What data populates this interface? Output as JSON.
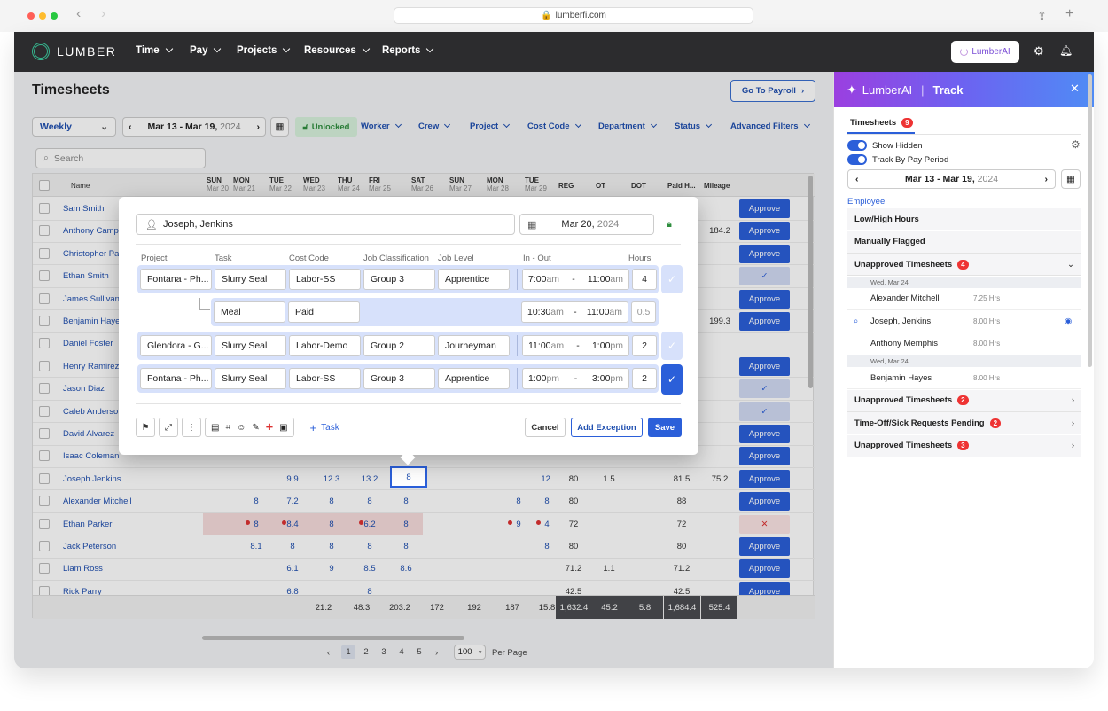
{
  "browser": {
    "url": "lumberfi.com"
  },
  "topbar": {
    "brand": "LUMBER",
    "nav": [
      "Time",
      "Pay",
      "Projects",
      "Resources",
      "Reports"
    ],
    "ai_button": "LumberAI"
  },
  "page": {
    "title": "Timesheets",
    "go_payroll": "Go To Payroll",
    "period": "Weekly",
    "range": "Mar 13 - Mar 19,",
    "range_year": "2024",
    "lock_status": "Unlocked",
    "filters": [
      "Worker",
      "Crew",
      "Project",
      "Cost Code",
      "Department",
      "Status",
      "Advanced Filters"
    ],
    "search_placeholder": "Search"
  },
  "grid": {
    "headers": [
      {
        "d": "SUN",
        "s": "Mar 20"
      },
      {
        "d": "MON",
        "s": "Mar 21"
      },
      {
        "d": "TUE",
        "s": "Mar 22"
      },
      {
        "d": "WED",
        "s": "Mar 23"
      },
      {
        "d": "THU",
        "s": "Mar 24"
      },
      {
        "d": "FRI",
        "s": "Mar 25"
      },
      {
        "d": "SAT",
        "s": "Mar 26"
      },
      {
        "d": "SUN",
        "s": "Mar 27"
      },
      {
        "d": "MON",
        "s": "Mar 28"
      },
      {
        "d": "TUE",
        "s": "Mar 29"
      }
    ],
    "cols": {
      "name": "Name",
      "reg": "REG",
      "ot": "OT",
      "dot": "DOT",
      "paid": "Paid H...",
      "mileage": "Mileage"
    },
    "rows": [
      {
        "name": "Sam Smith",
        "action": "Approve"
      },
      {
        "name": "Anthony Camp",
        "action": "Approve",
        "mileage": "184.2"
      },
      {
        "name": "Christopher Pa",
        "action": "Approve"
      },
      {
        "name": "Ethan Smith",
        "action": "ok"
      },
      {
        "name": "James Sullivan",
        "action": "Approve"
      },
      {
        "name": "Benjamin Haye",
        "action": "Approve",
        "mileage": "199.3"
      },
      {
        "name": "Daniel Foster",
        "action": ""
      },
      {
        "name": "Henry Ramirez",
        "action": "Approve"
      },
      {
        "name": "Jason Diaz",
        "action": "ok"
      },
      {
        "name": "Caleb Anderso",
        "action": "ok"
      },
      {
        "name": "David Alvarez",
        "action": "Approve"
      },
      {
        "name": "Isaac Coleman",
        "action": "Approve"
      },
      {
        "name": "Joseph Jenkins",
        "action": "Approve",
        "days": [
          "",
          "",
          "9.9",
          "12.3",
          "13.2",
          "8",
          "",
          "",
          "",
          "12."
        ],
        "reg": "80",
        "ot": "1.5",
        "dot": "",
        "paid": "81.5",
        "mileage": "75.2"
      },
      {
        "name": "Alexander Mitchell",
        "action": "Approve",
        "days": [
          "",
          "8",
          "7.2",
          "8",
          "8",
          "8",
          "",
          "",
          "8",
          "8"
        ],
        "reg": "80",
        "ot": "",
        "dot": "",
        "paid": "88",
        "mileage": ""
      },
      {
        "name": "Ethan Parker",
        "action": "reject",
        "days": [
          "",
          "8",
          "8.4",
          "8",
          "6.2",
          "8",
          "",
          "",
          "9",
          "4"
        ],
        "reg": "72",
        "ot": "",
        "dot": "",
        "paid": "72",
        "mileage": ""
      },
      {
        "name": "Jack Peterson",
        "action": "Approve",
        "days": [
          "",
          "8.1",
          "8",
          "8",
          "8",
          "8",
          "",
          "",
          "",
          "8"
        ],
        "reg": "80",
        "ot": "",
        "dot": "",
        "paid": "80",
        "mileage": ""
      },
      {
        "name": "Liam Ross",
        "action": "Approve",
        "days": [
          "",
          "",
          "6.1",
          "9",
          "8.5",
          "8.6",
          "",
          "",
          "",
          ""
        ],
        "reg": "71.2",
        "ot": "1.1",
        "dot": "",
        "paid": "71.2",
        "mileage": ""
      },
      {
        "name": "Rick Parry",
        "action": "Approve",
        "days": [
          "",
          "",
          "6.8",
          "",
          "8",
          "",
          "",
          "",
          "",
          ""
        ],
        "reg": "42.5",
        "ot": "",
        "dot": "",
        "paid": "42.5",
        "mileage": ""
      }
    ],
    "totals": [
      "",
      "",
      "21.2",
      "48.3",
      "203.2",
      "172",
      "192",
      "187",
      "15.8"
    ],
    "totals_dark": [
      "1,632.4",
      "45.2",
      "5.8",
      "1,684.4",
      "525.4"
    ],
    "pager": {
      "prev": "‹",
      "pages": [
        "1",
        "2",
        "3",
        "4",
        "5"
      ],
      "next": "›",
      "size": "100",
      "per_page": "Per Page"
    }
  },
  "modal": {
    "employee": "Joseph, Jenkins",
    "date": "Mar 20,",
    "date_year": "2024",
    "cols": {
      "project": "Project",
      "task": "Task",
      "cost_code": "Cost Code",
      "job_class": "Job Classification",
      "job_level": "Job Level",
      "in_out": "In - Out",
      "hours": "Hours"
    },
    "entries": [
      {
        "project": "Fontana - Ph...",
        "task": "Slurry Seal",
        "cost": "Labor-SS",
        "group": "Group 3",
        "level": "Apprentice",
        "in": "7:00",
        "in_ap": "am",
        "out": "11:00",
        "out_ap": "am",
        "hours": "4"
      },
      {
        "project": "Glendora - G...",
        "task": "Slurry Seal",
        "cost": "Labor-Demo",
        "group": "Group 2",
        "level": "Journeyman",
        "in": "11:00",
        "in_ap": "am",
        "out": "1:00",
        "out_ap": "pm",
        "hours": "2"
      },
      {
        "project": "Fontana - Ph...",
        "task": "Slurry Seal",
        "cost": "Labor-SS",
        "group": "Group 3",
        "level": "Apprentice",
        "in": "1:00",
        "in_ap": "pm",
        "out": "3:00",
        "out_ap": "pm",
        "hours": "2"
      }
    ],
    "meal": {
      "task": "Meal",
      "cost": "Paid",
      "in": "10:30",
      "in_ap": "am",
      "out": "11:00",
      "out_ap": "am",
      "hours": "0.5"
    },
    "add_task": "Task",
    "cancel": "Cancel",
    "add_exception": "Add Exception",
    "save": "Save"
  },
  "panel": {
    "title_ai": "LumberAI",
    "title_track": "Track",
    "tab": "Timesheets",
    "tab_count": "9",
    "show_hidden": "Show Hidden",
    "track_pay": "Track By Pay Period",
    "range": "Mar 13 - Mar 19,",
    "range_year": "2024",
    "employee_label": "Employee",
    "sections": [
      {
        "label": "Low/High Hours"
      },
      {
        "label": "Manually Flagged"
      },
      {
        "label": "Unapproved Timesheets",
        "count": "4"
      }
    ],
    "sub": [
      {
        "date": "Wed, Mar 24"
      },
      {
        "name": "Alexander Mitchell",
        "hrs": "7.25 Hrs"
      },
      {
        "name": "Joseph, Jenkins",
        "hrs": "8.00 Hrs"
      },
      {
        "name": "Anthony Memphis",
        "hrs": "8.00 Hrs"
      },
      {
        "date": "Wed, Mar 24"
      },
      {
        "name": "Benjamin Hayes",
        "hrs": "8.00 Hrs"
      }
    ],
    "more": [
      {
        "label": "Unapproved Timesheets",
        "count": "2"
      },
      {
        "label": "Time-Off/Sick Requests Pending",
        "count": "2"
      },
      {
        "label": "Unapproved Timesheets",
        "count": "3"
      }
    ]
  },
  "colors": {
    "primary": "#2b5fd9",
    "topbar": "#2c2c2e",
    "unlocked": "#2f8e3f",
    "flag": "#d33"
  }
}
